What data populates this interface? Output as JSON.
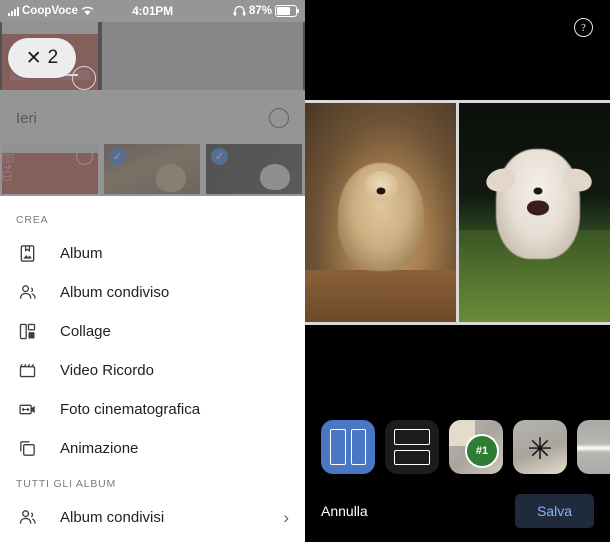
{
  "statusbar": {
    "carrier": "CoopVoce",
    "time": "4:01PM",
    "battery_percent": "87%",
    "signal_icon": "signal-bars-icon",
    "wifi_icon": "wifi-icon",
    "headphones_icon": "headphones-icon",
    "battery_icon": "battery-icon"
  },
  "annotation": {
    "close_glyph": "✕",
    "count": "2"
  },
  "picker": {
    "date_label": "Ieri",
    "select_all_icon": "circle-unselected-icon",
    "thumbnails": [
      {
        "name": "thumbnail-red-card",
        "selected": false,
        "badge": "circle-unselected-icon"
      },
      {
        "name": "thumbnail-dog-brown",
        "selected": true,
        "badge": "check-icon"
      },
      {
        "name": "thumbnail-dog-white",
        "selected": true,
        "badge": "check-icon"
      }
    ],
    "check_glyph": "✓"
  },
  "menu": {
    "crea_header": "CREA",
    "crea_items": [
      {
        "label": "Album",
        "icon": "album-icon"
      },
      {
        "label": "Album condiviso",
        "icon": "people-icon"
      },
      {
        "label": "Collage",
        "icon": "collage-icon"
      },
      {
        "label": "Video Ricordo",
        "icon": "clapperboard-icon"
      },
      {
        "label": "Foto cinematografica",
        "icon": "cinematic-camera-icon"
      },
      {
        "label": "Animazione",
        "icon": "layers-icon"
      }
    ],
    "all_albums_header": "TUTTI GLI ALBUM",
    "all_albums_items": [
      {
        "label": "Album condivisi",
        "icon": "people-icon",
        "chevron": "›"
      }
    ]
  },
  "editor": {
    "help_icon": "help-icon",
    "help_glyph": "?",
    "collage": {
      "photos": [
        {
          "name": "photo-dog-brown"
        },
        {
          "name": "photo-dog-white"
        }
      ]
    },
    "layout_options": [
      {
        "name": "layout-two-columns",
        "selected": true
      },
      {
        "name": "layout-two-rows",
        "selected": false
      },
      {
        "name": "template-number-one",
        "selected": false,
        "badge": "#1"
      },
      {
        "name": "template-starburst",
        "selected": false,
        "glyph": "✳"
      },
      {
        "name": "template-stripe",
        "selected": false
      }
    ],
    "cancel_label": "Annulla",
    "save_label": "Salva"
  },
  "colors": {
    "accent_blue": "#1a73e8",
    "save_text": "#8ab4f8",
    "save_bg": "#1f2a3d",
    "selected_layout": "#4a77c4",
    "badge_green": "#2e7d32"
  }
}
